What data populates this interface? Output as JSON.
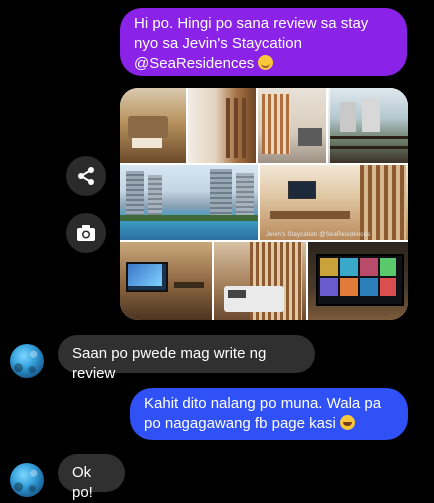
{
  "messages": {
    "first": {
      "text": "Hi po. Hingi po sana review sa stay nyo sa Jevin's Staycation @SeaResidences ",
      "emoji": "smiling-face"
    },
    "second": {
      "text": "Saan po pwede mag write ng review"
    },
    "third": {
      "text": "Kahit dito nalang po muna. Wala pa po nagagawang fb page kasi ",
      "emoji": "rolling-on-floor-laughing-face"
    },
    "fourth": {
      "text": "Ok po!"
    }
  },
  "gallery": {
    "watermark": "Jevin's Staycation @SeaResidences",
    "photos": [
      "living-room",
      "kitchen-hallway",
      "slatted-wall-room",
      "white-room",
      "balcony-view",
      "pool-towers",
      "tv-lounge",
      "tv-dining",
      "bedroom",
      "tv-screen"
    ]
  },
  "actions": {
    "share_icon": "share-icon",
    "camera_icon": "camera-icon"
  },
  "colors": {
    "background": "#000000",
    "outgoing_purple": "#8a22e8",
    "outgoing_blue": "#2f51f5",
    "incoming_gray": "#303030"
  }
}
